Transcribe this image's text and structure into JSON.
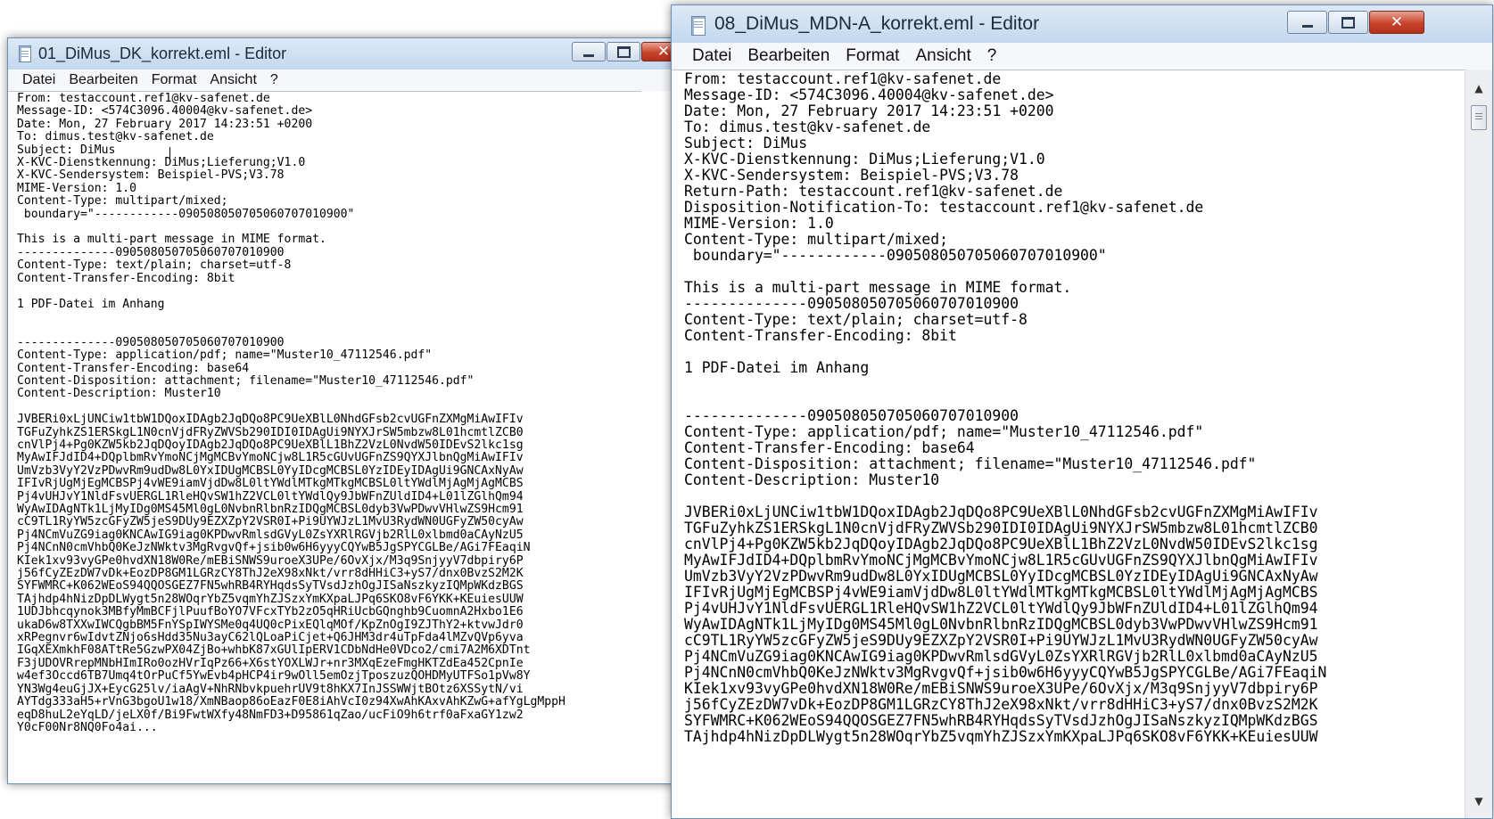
{
  "colors": {
    "titlebar": "#c3d8ee",
    "close_button": "#c7432b",
    "menubar": "#f5f7fa"
  },
  "left_window": {
    "title": "01_DiMus_DK_korrekt.eml - Editor",
    "menu": [
      "Datei",
      "Bearbeiten",
      "Format",
      "Ansicht",
      "?"
    ],
    "content": "From: testaccount.ref1@kv-safenet.de\nMessage-ID: <574C3096.40004@kv-safenet.de>\nDate: Mon, 27 February 2017 14:23:51 +0200\nTo: dimus.test@kv-safenet.de\nSubject: DiMus\nX-KVC-Dienstkennung: DiMus;Lieferung;V1.0\nX-KVC-Sendersystem: Beispiel-PVS;V3.78\nMIME-Version: 1.0\nContent-Type: multipart/mixed;\n boundary=\"------------090508050705060707010900\"\n\nThis is a multi-part message in MIME format.\n--------------090508050705060707010900\nContent-Type: text/plain; charset=utf-8\nContent-Transfer-Encoding: 8bit\n\n1 PDF-Datei im Anhang\n\n\n--------------090508050705060707010900\nContent-Type: application/pdf; name=\"Muster10_47112546.pdf\"\nContent-Transfer-Encoding: base64\nContent-Disposition: attachment; filename=\"Muster10_47112546.pdf\"\nContent-Description: Muster10\n\nJVBERi0xLjUNCiw1tbW1DQoxIDAgb2JqDQo8PC9UeXBlL0NhdGFsb2cvUGFnZXMgMiAwIFIv\nTGFuZyhkZS1ERSkgL1N0cnVjdFRyZWVSb290IDI0IDAgUi9NYXJrSW5mbzw8L01hcmtlZCB0\ncnVlPj4+Pg0KZW5kb2JqDQoyIDAgb2JqDQo8PC9UeXBlL1BhZ2VzL0NvdW50IDEvS2lkc1sg\nMyAwIFJdID4+DQplbmRvYmoNCjMgMCBvYmoNCjw8L1R5cGUvUGFnZS9QYXJlbnQgMiAwIFIv\nUmVzb3VyY2VzPDwvRm9udDw8L0YxIDUgMCBSL0YyIDcgMCBSL0YzIDEyIDAgUi9GNCAxNyAw\nIFIvRjUgMjEgMCBSPj4vWE9iamVjdDw8L0ltYWdlMTkgMTkgMCBSL0ltYWdlMjAgMjAgMCBS\nPj4vUHJvY1NldFsvUERGL1RleHQvSW1hZ2VCL0ltYWdlQy9JbWFnZUldID4+L01lZGlhQm94\nWyAwIDAgNTk1LjMyIDg0MS45Ml0gL0NvbnRlbnRzIDQgMCBSL0dyb3VwPDwvVHlwZS9Hcm91\ncC9TL1RyYW5zcGFyZW5jeS9DUy9EZXZpY2VSR0I+Pi9UYWJzL1MvU3RydWN0UGFyZW50cyAw\nPj4NCmVuZG9iag0KNCAwIG9iag0KPDwvRmlsdGVyL0ZsYXRlRGVjb2RlL0xlbmd0aCAyNzU5\nPj4NCnN0cmVhbQ0KeJzNWktv3MgRvgvQf+jsib0w6H6yyyCQYwB5JgSPYCGLBe/AGi7FEaqiN\nKIek1xv93vyGPe0hvdXN18W0Re/mEBiSNWS9uroeX3UPe/6OvXjx/M3q9SnjyyV7dbpiry6P\nj56fCyZEzDW7vDk+EozDP8GM1LGRzCY8ThJ2eX98xNkt/vrr8dHHiC3+yS7/dnx0BvzS2M2K\nSYFWMRC+K062WEoS94QQOSGEZ7FN5whRB4RYHqdsSyTVsdJzhOgJISaNszkyzIQMpWKdzBGS\nTAjhdp4hNizDpDLWygt5n28WOqrYbZ5vqmYhZJSzxYmKXpaLJPq6SKO8vF6YKK+KEuiesUUW\n1UDJbhcqynok3MBfyMmBCFjlPuufBoYO7VFcxTYb2zO5qHRiUcbGQnghb9CuomnA2Hxbo1E6\nukaD6w8TXXwIWCQgbBM5FnYSpIWYSMe0q4UQ0cPixEQlqMOf/KpZnOgI9ZJThY2+ktvwJdr0\nxRPegnvr6wIdvtZNjo6sHdd35Nu3ayC62lQLoaPiCjet+Q6JHM3dr4uTpFda4lMZvQVp6yva\nIGqXEXmkhF08ATtRe5GzwPX04ZjBo+whbK87xGUlIpERV1CDbNdHe0VDco2/cmi7A2M6XDTnt\nF3jUDOVRrepMNbHImIRo0ozHVrIqPz66+X6stYOXLWJr+nr3MXqEzeFmgHKTZdEa452CpnIe\nw4ef3Occd6TB7Umq4tOrPuCf5YwEvb4pHCP4ir9wOll5emOzjTposzuzQOHDMyUTFSo1pVw8Y\nYN3Wg4euGjJX+EycG25lv/iaAgV+NhRNbvkpuehrUV9t8hKX7InJSSWWjtBOtz6XSSytN/vi\nAYTdg333aH5+rVnG3bgoU1w18/XmNBaop86oEazF0E8iAhVcI0z94XwAhKAxvAhKZwG+afYgLgMppH\neqD8huL2eYqLD/jeLX0f/Bi9FwtWXfy48NmFD3+D95861qZao/ucFiO9h6trf0aFxaGY1zw2\nY0cF00Nr8NQ0Fo4ai..."
  },
  "right_window": {
    "title": "08_DiMus_MDN-A_korrekt.eml - Editor",
    "menu": [
      "Datei",
      "Bearbeiten",
      "Format",
      "Ansicht",
      "?"
    ],
    "content": "From: testaccount.ref1@kv-safenet.de\nMessage-ID: <574C3096.40004@kv-safenet.de>\nDate: Mon, 27 February 2017 14:23:51 +0200\nTo: dimus.test@kv-safenet.de\nSubject: DiMus\nX-KVC-Dienstkennung: DiMus;Lieferung;V1.0\nX-KVC-Sendersystem: Beispiel-PVS;V3.78\nReturn-Path: testaccount.ref1@kv-safenet.de\nDisposition-Notification-To: testaccount.ref1@kv-safenet.de\nMIME-Version: 1.0\nContent-Type: multipart/mixed;\n boundary=\"------------090508050705060707010900\"\n\nThis is a multi-part message in MIME format.\n--------------090508050705060707010900\nContent-Type: text/plain; charset=utf-8\nContent-Transfer-Encoding: 8bit\n\n1 PDF-Datei im Anhang\n\n\n--------------090508050705060707010900\nContent-Type: application/pdf; name=\"Muster10_47112546.pdf\"\nContent-Transfer-Encoding: base64\nContent-Disposition: attachment; filename=\"Muster10_47112546.pdf\"\nContent-Description: Muster10\n\nJVBERi0xLjUNCiw1tbW1DQoxIDAgb2JqDQo8PC9UeXBlL0NhdGFsb2cvUGFnZXMgMiAwIFIv\nTGFuZyhkZS1ERSkgL1N0cnVjdFRyZWVSb290IDI0IDAgUi9NYXJrSW5mbzw8L01hcmtlZCB0\ncnVlPj4+Pg0KZW5kb2JqDQoyIDAgb2JqDQo8PC9UeXBlL1BhZ2VzL0NvdW50IDEvS2lkc1sg\nMyAwIFJdID4+DQplbmRvYmoNCjMgMCBvYmoNCjw8L1R5cGUvUGFnZS9QYXJlbnQgMiAwIFIv\nUmVzb3VyY2VzPDwvRm9udDw8L0YxIDUgMCBSL0YyIDcgMCBSL0YzIDEyIDAgUi9GNCAxNyAw\nIFIvRjUgMjEgMCBSPj4vWE9iamVjdDw8L0ltYWdlMTkgMTkgMCBSL0ltYWdlMjAgMjAgMCBS\nPj4vUHJvY1NldFsvUERGL1RleHQvSW1hZ2VCL0ltYWdlQy9JbWFnZUldID4+L01lZGlhQm94\nWyAwIDAgNTk1LjMyIDg0MS45Ml0gL0NvbnRlbnRzIDQgMCBSL0dyb3VwPDwvVHlwZS9Hcm91\ncC9TL1RyYW5zcGFyZW5jeS9DUy9EZXZpY2VSR0I+Pi9UYWJzL1MvU3RydWN0UGFyZW50cyAw\nPj4NCmVuZG9iag0KNCAwIG9iag0KPDwvRmlsdGVyL0ZsYXRlRGVjb2RlL0xlbmd0aCAyNzU5\nPj4NCnN0cmVhbQ0KeJzNWktv3MgRvgvQf+jsib0w6H6yyyCQYwB5JgSPYCGLBe/AGi7FEaqiN\nKIek1xv93vyGPe0hvdXN18W0Re/mEBiSNWS9uroeX3UPe/6OvXjx/M3q9SnjyyV7dbpiry6P\nj56fCyZEzDW7vDk+EozDP8GM1LGRzCY8ThJ2eX98xNkt/vrr8dHHiC3+yS7/dnx0BvzS2M2K\nSYFWMRC+K062WEoS94QQOSGEZ7FN5whRB4RYHqdsSyTVsdJzhOgJISaNszkyzIQMpWKdzBGS\nTAjhdp4hNizDpDLWygt5n28WOqrYbZ5vqmYhZJSzxYmKXpaLJPq6SKO8vF6YKK+KEuiesUUW"
  }
}
